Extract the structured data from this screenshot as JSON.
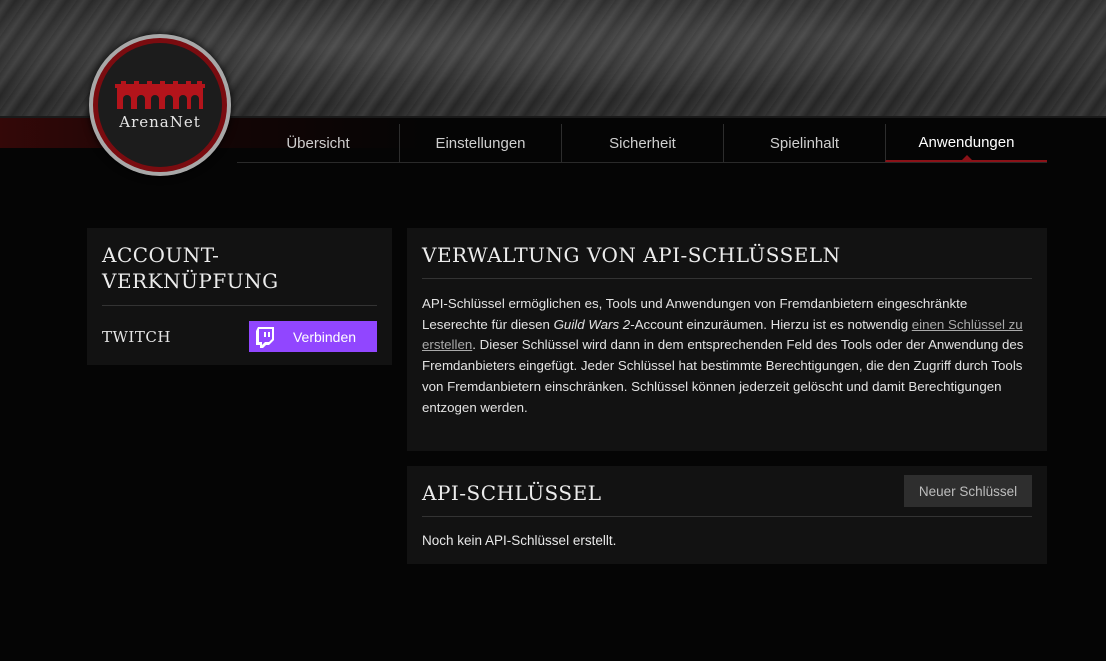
{
  "logo": {
    "text": "ArenaNet"
  },
  "tabs": [
    {
      "label": "Übersicht",
      "active": false
    },
    {
      "label": "Einstellungen",
      "active": false
    },
    {
      "label": "Sicherheit",
      "active": false
    },
    {
      "label": "Spielinhalt",
      "active": false
    },
    {
      "label": "Anwendungen",
      "active": true
    }
  ],
  "account_link": {
    "title": "Account-Verknüpfung",
    "service": "Twitch",
    "button_label": "Verbinden",
    "button_color": "#9146ff",
    "icon": "twitch-icon"
  },
  "api_management": {
    "title": "Verwaltung von API-Schlüsseln",
    "text_part1": "API-Schlüssel ermöglichen es, Tools und Anwendungen von Fremdanbietern eingeschränkte Leserechte für diesen ",
    "text_game": "Guild Wars 2",
    "text_part2": "-Account einzuräumen. Hierzu ist es notwendig ",
    "link_text": "einen Schlüssel zu erstellen",
    "text_part3": ". Dieser Schlüssel wird dann in dem entsprechenden Feld des Tools oder der Anwendung des Fremdanbieters eingefügt. Jeder Schlüssel hat bestimmte Berechtigungen, die den Zugriff durch Tools von Fremdanbietern einschränken. Schlüssel können jederzeit gelöscht und damit Berechtigungen entzogen werden."
  },
  "api_keys": {
    "title": "API-Schlüssel",
    "new_key_button": "Neuer Schlüssel",
    "empty_message": "Noch kein API-Schlüssel erstellt."
  },
  "colors": {
    "accent": "#8b1218",
    "twitch": "#9146ff",
    "panel": "#121212"
  }
}
